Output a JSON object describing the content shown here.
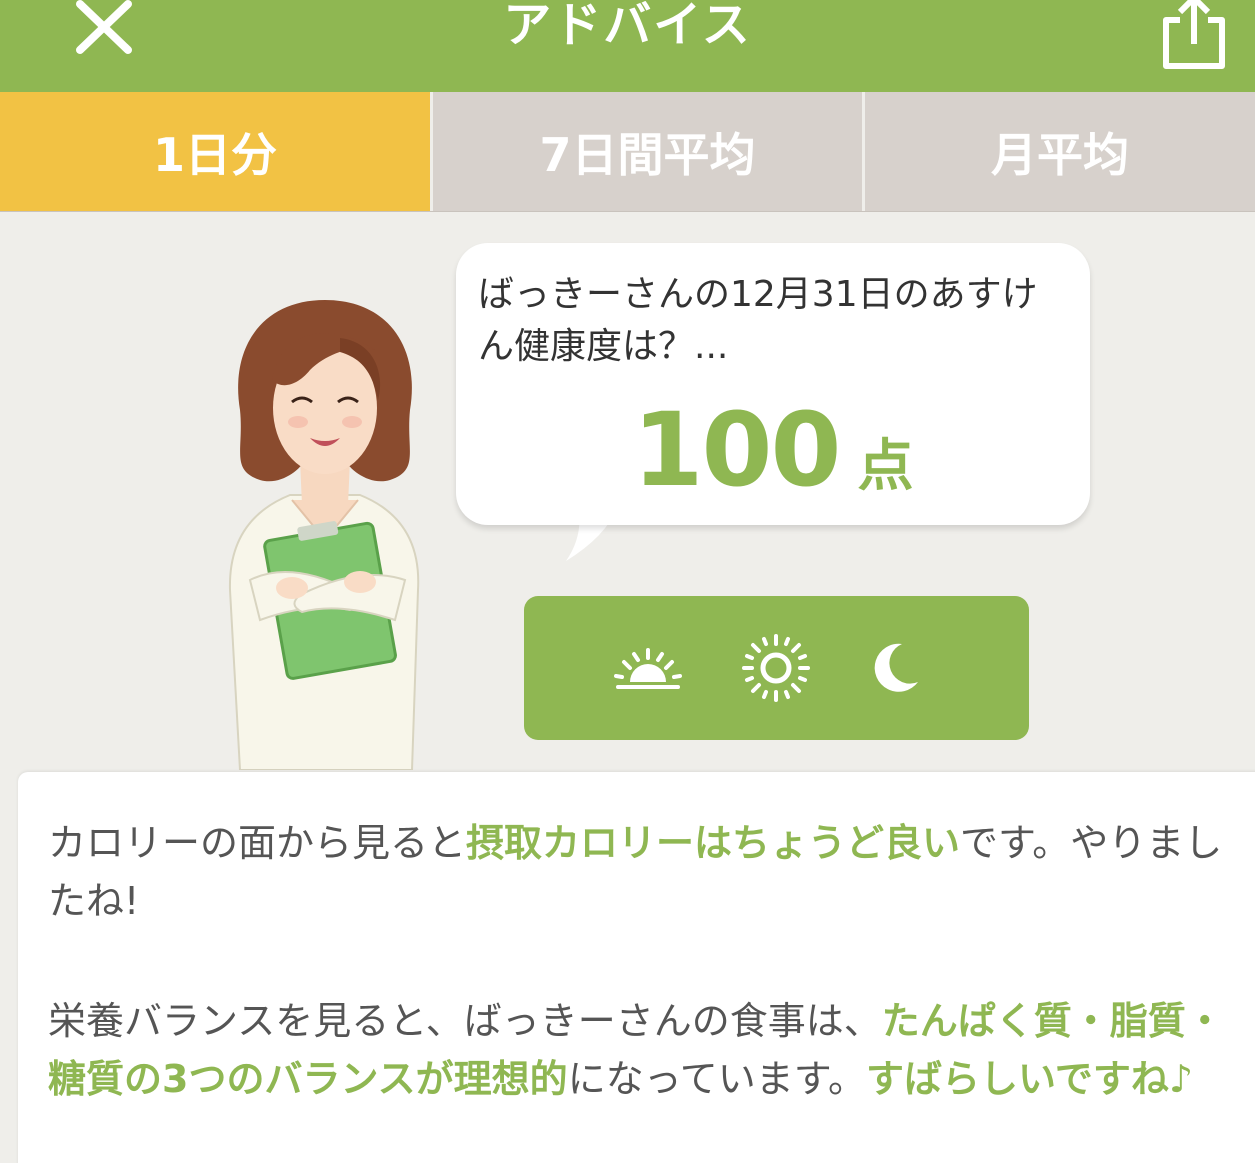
{
  "header": {
    "title": "アドバイス",
    "close_icon": "close-icon",
    "share_icon": "share-icon"
  },
  "tabs": [
    {
      "label": "1日分",
      "selected": true
    },
    {
      "label": "7日間平均",
      "selected": false
    },
    {
      "label": "月平均",
      "selected": false
    }
  ],
  "bubble": {
    "question": "ばっきーさんの12月31日のあすけん健康度は？...",
    "score": "100",
    "unit": "点"
  },
  "meals": {
    "icons": [
      "sunrise-icon",
      "sun-icon",
      "moon-icon"
    ]
  },
  "advice": {
    "p1": {
      "a": "カロリーの面から見ると",
      "b": "摂取カロリーはちょうど良い",
      "c": "です。やりましたね!"
    },
    "p2": {
      "a": "栄養バランスを見ると、ばっきーさんの食事は、",
      "b": "たんぱく質・脂質・糖質の3つのバランスが理想的",
      "c": "になっています。",
      "d": "すばらしいですね♪"
    }
  },
  "colors": {
    "brand_green": "#8fb752",
    "tab_selected": "#f2c244",
    "tab_unselected": "#d7d1cc",
    "background": "#efeeea"
  }
}
